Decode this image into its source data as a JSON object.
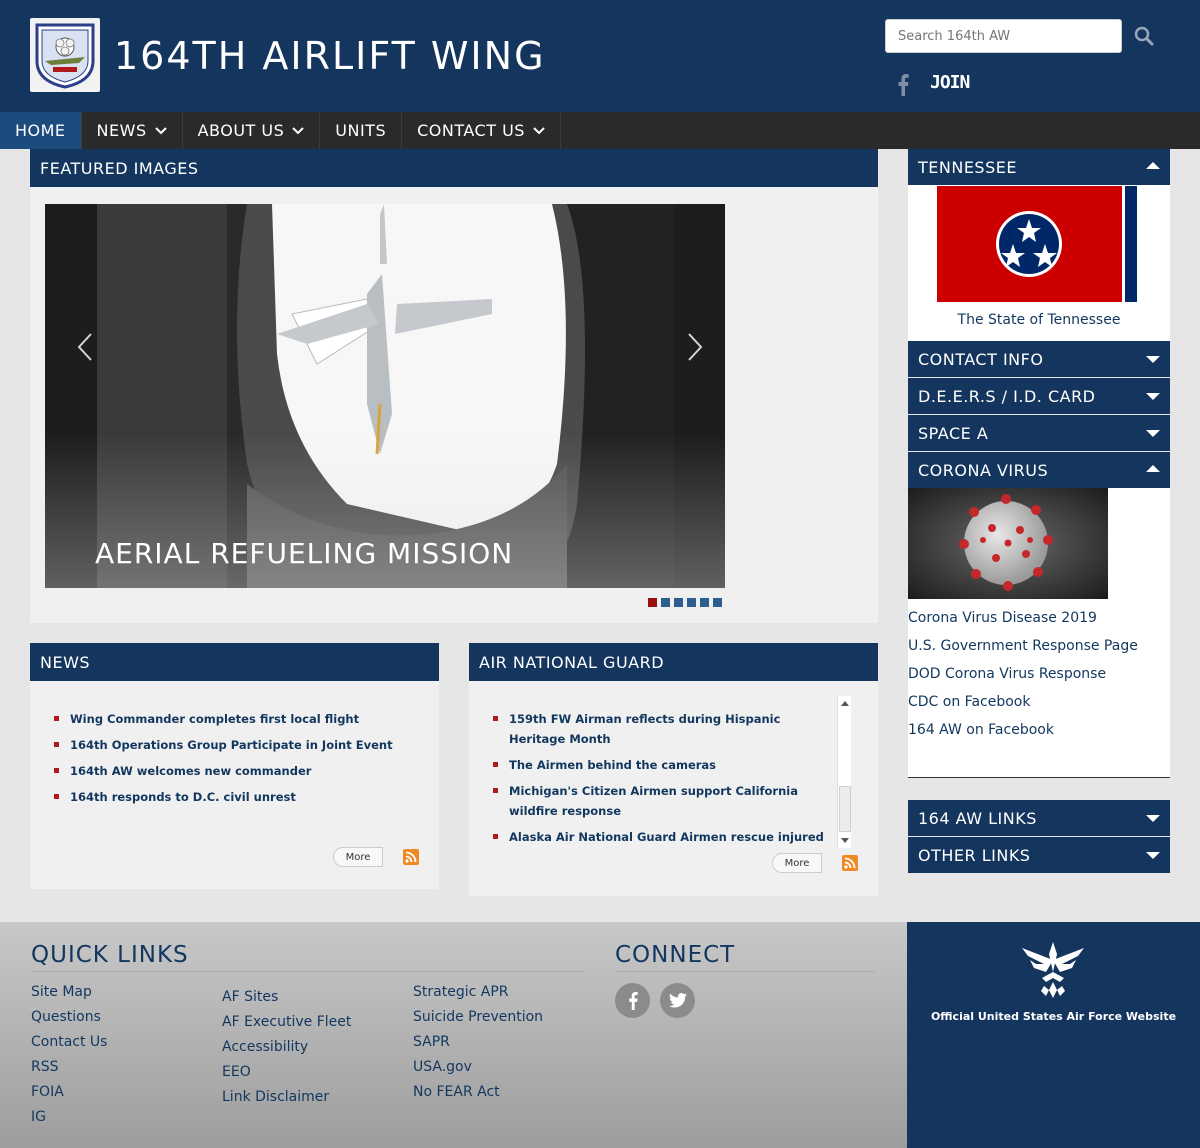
{
  "header": {
    "title": "164TH AIRLIFT WING",
    "search_placeholder": "Search 164th AW",
    "join_label": "JOIN"
  },
  "nav": {
    "items": [
      {
        "label": "HOME"
      },
      {
        "label": "NEWS"
      },
      {
        "label": "ABOUT US"
      },
      {
        "label": "UNITS"
      },
      {
        "label": "CONTACT US"
      }
    ]
  },
  "featured": {
    "heading": "FEATURED IMAGES",
    "caption": "AERIAL REFUELING MISSION",
    "slide_count": 6,
    "active_slide": 1
  },
  "news": {
    "heading": "NEWS",
    "items": [
      "Wing Commander completes first local flight",
      "164th Operations Group Participate in Joint Event",
      "164th AW welcomes new commander",
      "164th responds to D.C. civil unrest"
    ],
    "more_label": "More"
  },
  "ang": {
    "heading": "AIR NATIONAL GUARD",
    "items": [
      "159th FW Airman reflects during Hispanic Heritage Month",
      "The Airmen behind the cameras",
      "Michigan's Citizen Airmen support California wildfire response",
      "Alaska Air National Guard Airmen rescue injured"
    ],
    "more_label": "More"
  },
  "sidebar": {
    "tennessee": {
      "heading": "TENNESSEE",
      "link": "The State of Tennessee"
    },
    "contact": {
      "heading": "CONTACT INFO"
    },
    "deers": {
      "heading": "D.E.E.R.S / I.D. CARD"
    },
    "spacea": {
      "heading": "SPACE A"
    },
    "corona": {
      "heading": "CORONA VIRUS",
      "links": [
        "Corona Virus Disease 2019",
        "U.S. Government Response Page",
        "DOD Corona Virus Response",
        "CDC on Facebook",
        "164 AW on Facebook"
      ]
    },
    "aw_links": {
      "heading": "164 AW LINKS"
    },
    "other_links": {
      "heading": "OTHER LINKS"
    }
  },
  "footer": {
    "quick_links_heading": "QUICK LINKS",
    "col1": [
      "Site Map",
      "Questions",
      "Contact Us",
      "RSS",
      "FOIA",
      "IG"
    ],
    "col2": [
      "AF Sites",
      "AF Executive Fleet",
      "Accessibility",
      "EEO",
      "Link Disclaimer"
    ],
    "col3": [
      "Strategic APR",
      "Suicide Prevention",
      "SAPR",
      "USA.gov",
      "No FEAR Act"
    ],
    "connect_heading": "CONNECT",
    "af_text": "Official United States Air Force Website"
  },
  "colors": {
    "brand_navy": "#13355e",
    "nav_active": "#1c4c7d",
    "accent_red": "#b01a1a"
  }
}
